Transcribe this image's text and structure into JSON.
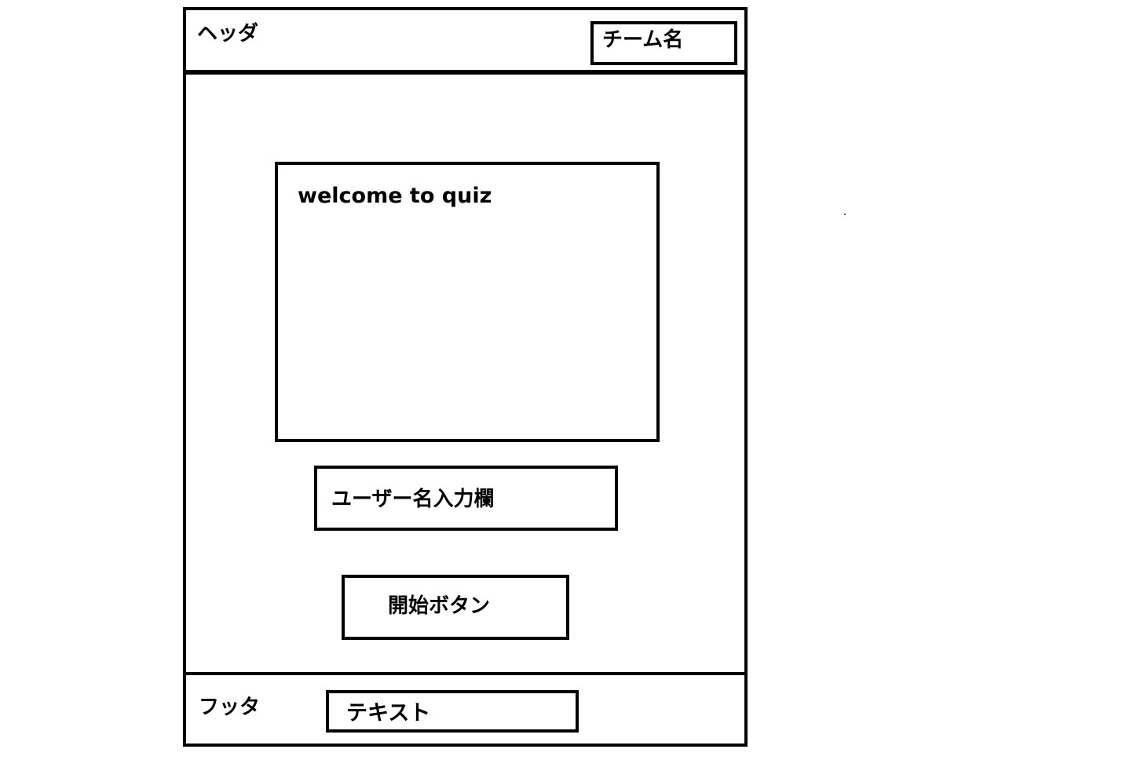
{
  "header": {
    "label": "ヘッダ",
    "team_name": "チーム名"
  },
  "main": {
    "welcome_text": "welcome to quiz",
    "username_field": "ユーザー名入力欄",
    "start_button": "開始ボタン"
  },
  "footer": {
    "label": "フッタ",
    "text": "テキスト"
  },
  "colors": {
    "line": "#000000",
    "background": "#ffffff"
  }
}
